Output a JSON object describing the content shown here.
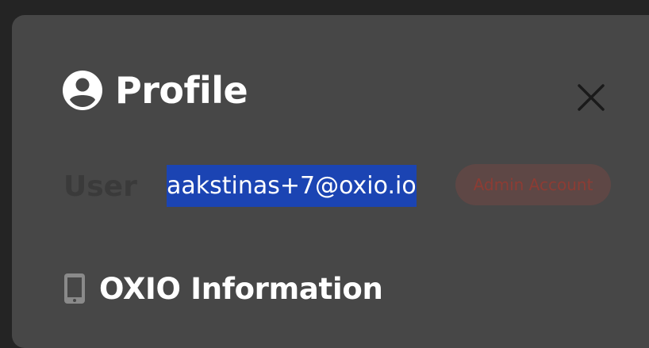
{
  "profile": {
    "title": "Profile",
    "close_icon": "close-icon",
    "avatar_icon": "account-circle-icon"
  },
  "user": {
    "label": "User",
    "email": "aakstinas+7@oxio.io",
    "badge": "Admin Account"
  },
  "section": {
    "icon": "smartphone-icon",
    "title": "OXIO Information"
  },
  "colors": {
    "background": "#242424",
    "panel": "#474747",
    "selection": "#1b44b3",
    "badge_bg": "#5e4745",
    "badge_text": "#8c3c34"
  }
}
